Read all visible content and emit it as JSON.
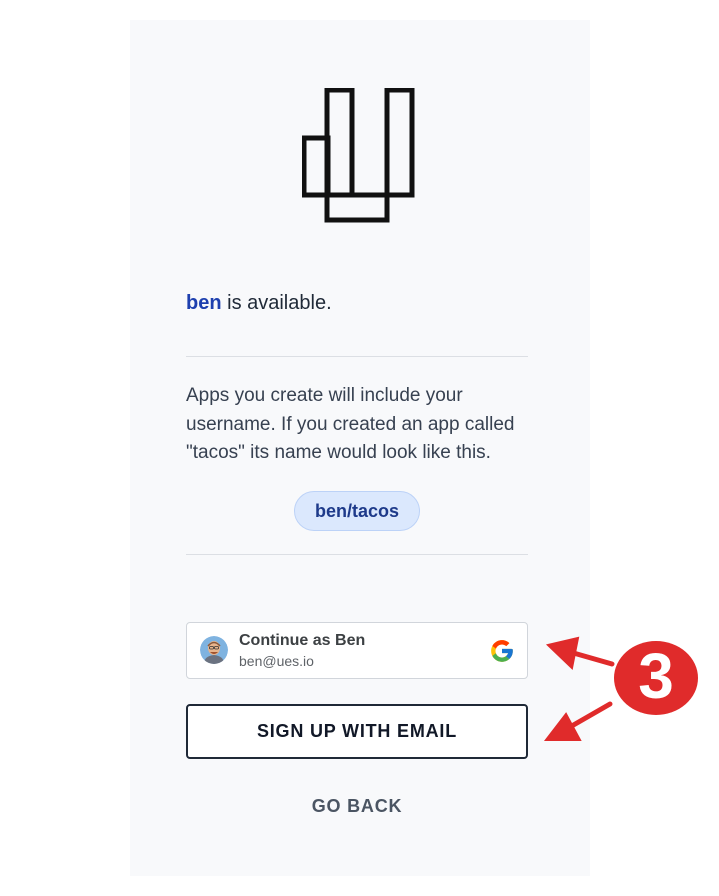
{
  "availability": {
    "username": "ben",
    "suffix": " is available."
  },
  "description": "Apps you create will include your username. If you created an app called \"tacos\" its name would look like this.",
  "example_app": "ben/tacos",
  "google_signin": {
    "name": "Continue as Ben",
    "email": "ben@ues.io",
    "avatar_icon": "avatar-icon",
    "provider_icon": "google-logo-icon"
  },
  "buttons": {
    "email_signup": "SIGN UP WITH EMAIL",
    "go_back": "GO BACK"
  },
  "annotation": {
    "step": "3",
    "color": "#e02b2b"
  },
  "colors": {
    "accent": "#1e40af",
    "chip_bg": "#dbe8fd"
  }
}
